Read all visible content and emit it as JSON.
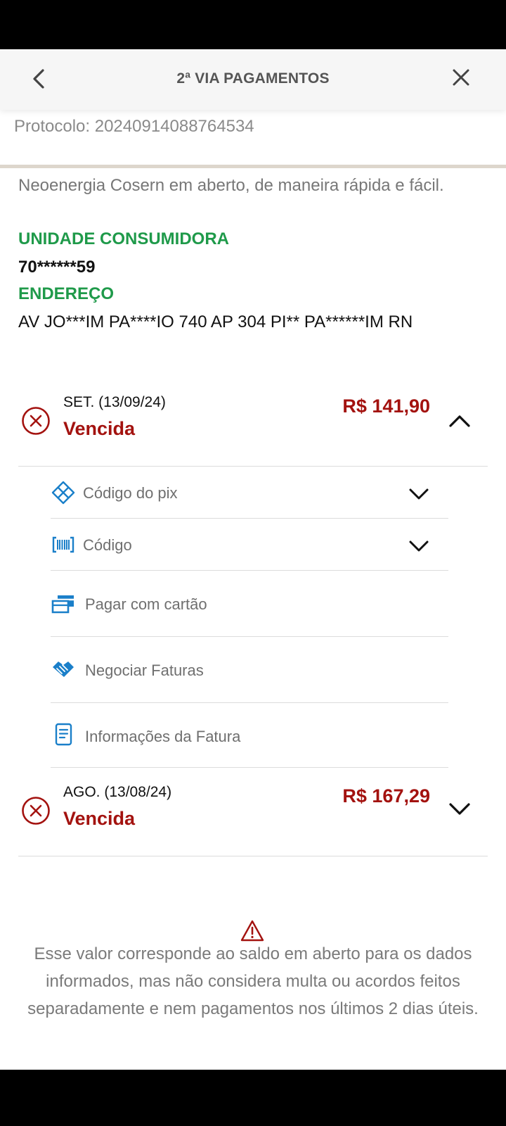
{
  "header": {
    "title": "2ª VIA PAGAMENTOS"
  },
  "protocol": "Protocolo: 20240914088764534",
  "intro": "Neoenergia Cosern em aberto, de maneira rápida e fácil.",
  "unit": {
    "label": "UNIDADE CONSUMIDORA",
    "value": "70******59"
  },
  "address": {
    "label": "ENDEREÇO",
    "value": "AV JO***IM PA****IO 740 AP 304 PI** PA******IM RN"
  },
  "bills": [
    {
      "date": "SET. (13/09/24)",
      "status": "Vencida",
      "amount": "R$ 141,90",
      "expanded": true
    },
    {
      "date": "AGO. (13/08/24)",
      "status": "Vencida",
      "amount": "R$ 167,29",
      "expanded": false
    }
  ],
  "options": [
    {
      "label": "Código do pix",
      "icon": "pix-icon"
    },
    {
      "label": "Código",
      "icon": "barcode-icon"
    },
    {
      "label": "Pagar com cartão",
      "icon": "card-icon"
    },
    {
      "label": "Negociar Faturas",
      "icon": "handshake-icon"
    },
    {
      "label": "Informações da Fatura",
      "icon": "document-icon"
    }
  ],
  "disclaimer": "Esse valor corresponde ao saldo em aberto para os dados informados, mas não considera multa ou acordos feitos separadamente e nem pagamentos nos últimos 2 dias úteis.",
  "colors": {
    "green": "#1f9a4a",
    "red": "#a3120f",
    "blue": "#1a7fc9"
  }
}
